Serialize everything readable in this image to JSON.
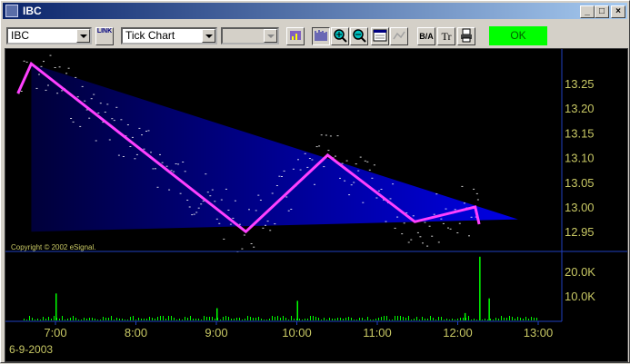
{
  "window": {
    "title": "IBC"
  },
  "toolbar": {
    "symbol": "IBC",
    "link_label": "LINK",
    "chart_type": "Tick Chart",
    "interval": "",
    "ok_label": "OK",
    "ba_label": "B/A",
    "tr_label": "Tr"
  },
  "chart": {
    "copyright": "Copyright © 2002 eSignal.",
    "date_label": "6-9-2003",
    "colors": {
      "background": "#000000",
      "triangle": "#0000ff",
      "zigzag": "#ff40ff",
      "ticks": "#ffffff",
      "volume": "#00ff00",
      "axis_text": "#c8c864"
    }
  },
  "chart_data": [
    {
      "type": "line",
      "price_axis_ticks": [
        "13.25",
        "13.20",
        "13.15",
        "13.10",
        "13.05",
        "13.00",
        "12.95"
      ],
      "time_axis_ticks": [
        "7:00",
        "8:00",
        "9:00",
        "10:00",
        "11:00",
        "12:00",
        "13:00"
      ],
      "ylim": [
        12.93,
        13.3
      ],
      "zigzag": {
        "x": [
          "6:32",
          "6:42",
          "9:22",
          "10:23",
          "11:28",
          "12:13",
          "12:16"
        ],
        "y": [
          13.23,
          13.29,
          12.95,
          13.105,
          12.97,
          13.0,
          12.965
        ]
      },
      "triangle": {
        "x": [
          "6:42",
          "6:42",
          "12:45"
        ],
        "y": [
          13.29,
          12.95,
          12.975
        ]
      }
    },
    {
      "type": "bar",
      "volume_axis_ticks": [
        "20.0K",
        "10.0K"
      ],
      "ylim": [
        0,
        26000
      ],
      "spikes": {
        "time": [
          "7:00",
          "9:00",
          "10:00",
          "12:05",
          "12:16",
          "12:23"
        ],
        "values": [
          11000,
          5000,
          8000,
          3000,
          26000,
          9000
        ]
      }
    }
  ]
}
